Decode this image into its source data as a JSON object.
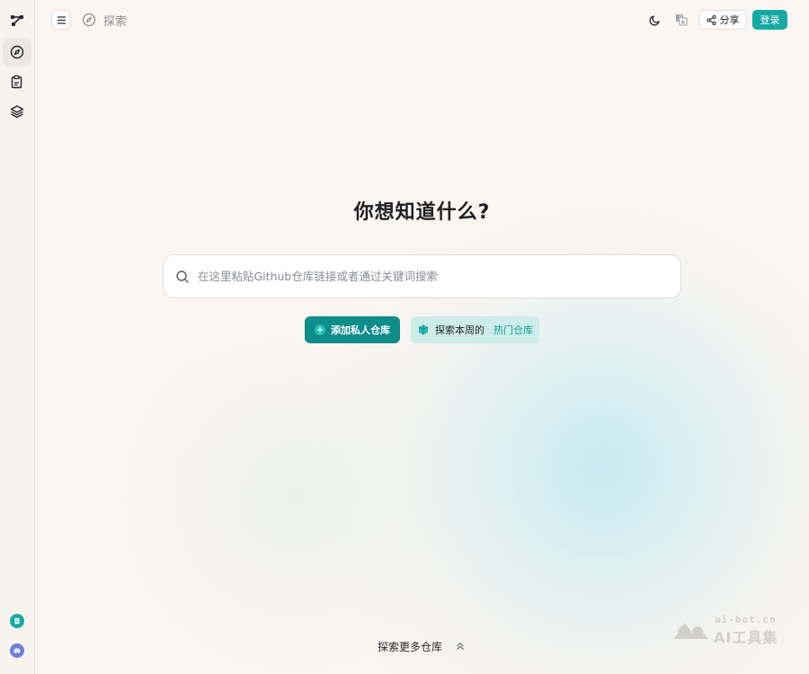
{
  "app": {
    "colors": {
      "accent": "#16aaa4",
      "accent_dark": "#0e8d8a",
      "accent_light": "#cdecea",
      "background": "#fbf5f1"
    }
  },
  "sidebar": {
    "items": [
      {
        "icon": "graph-logo-icon"
      },
      {
        "icon": "compass-icon",
        "active": true
      },
      {
        "icon": "clipboard-icon"
      },
      {
        "icon": "layers-icon"
      }
    ],
    "bottom": [
      {
        "icon": "document-circle-icon"
      },
      {
        "icon": "discord-icon"
      }
    ]
  },
  "header": {
    "breadcrumb_label": "探索",
    "share_label": "分享",
    "login_label": "登录"
  },
  "main": {
    "heading": "你想知道什么?",
    "search_placeholder": "在这里粘贴Github仓库链接或者通过关键词搜索",
    "add_repo_label": "添加私人仓库",
    "explore_label": "探索本周的",
    "explore_highlight": "热门仓库",
    "explore_more_label": "探索更多仓库"
  },
  "watermark": {
    "url": "ai-bot.cn",
    "text": "AI工具集"
  }
}
